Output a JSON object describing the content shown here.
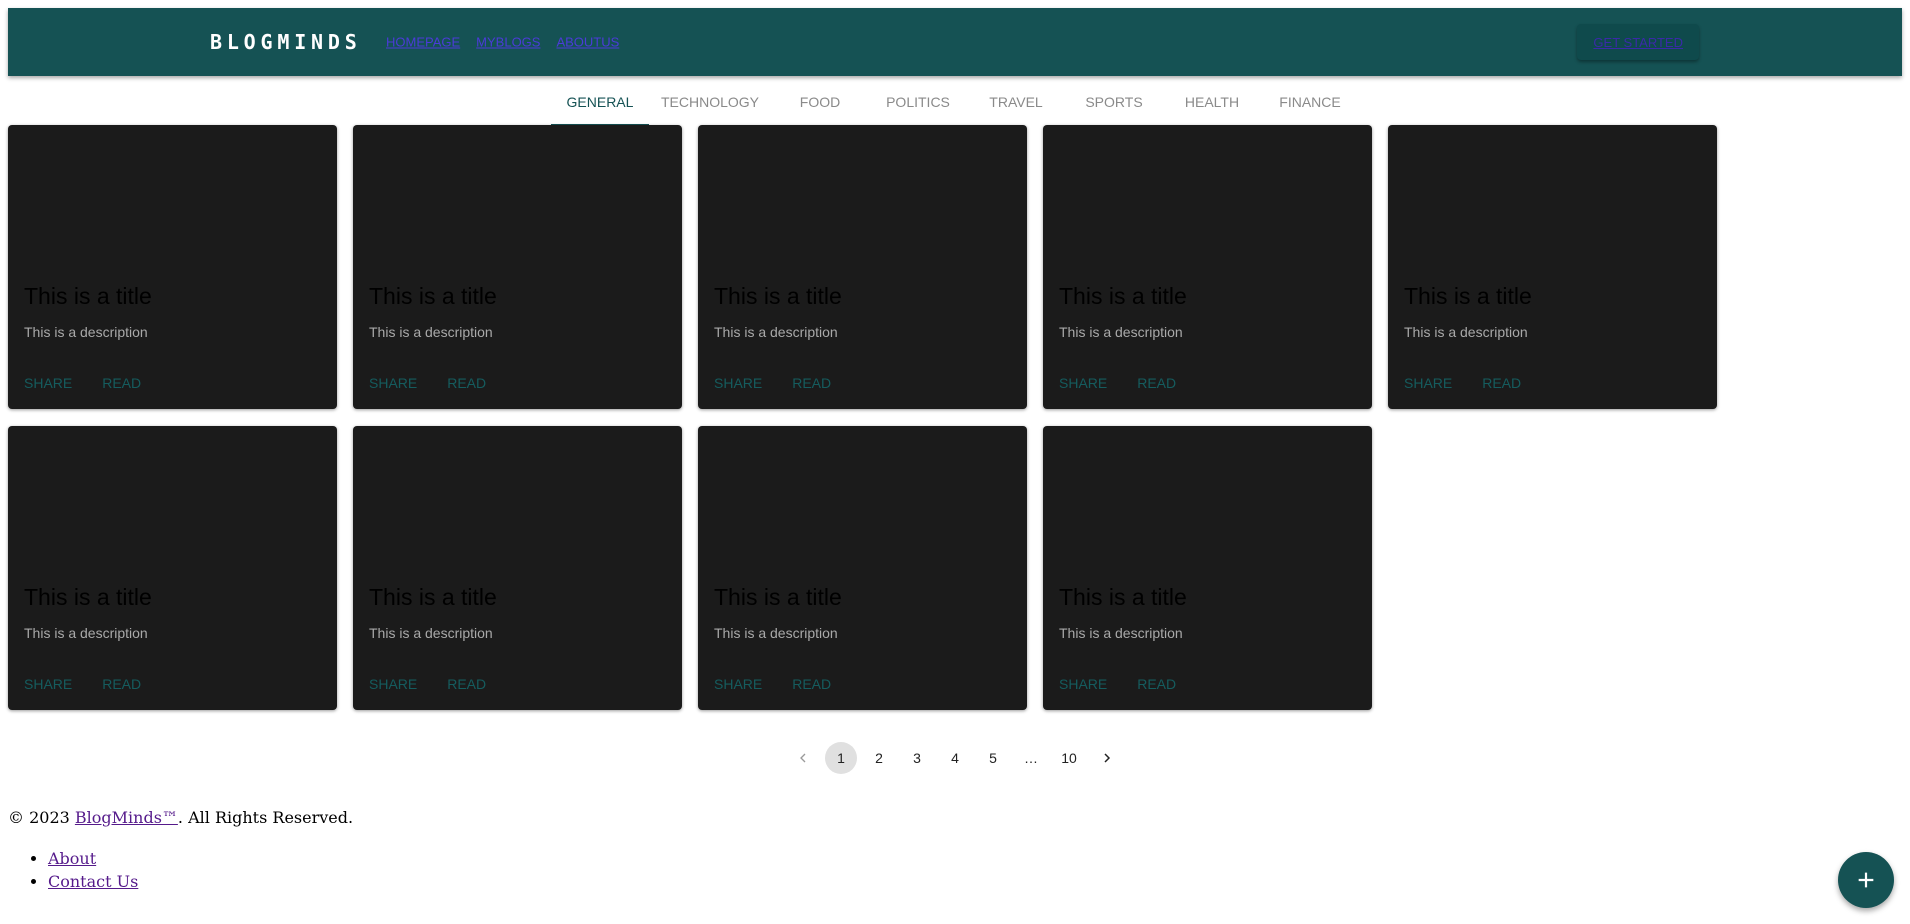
{
  "header": {
    "brand": "BLOGMINDS",
    "nav": [
      "HOMEPAGE",
      "MYBLOGS",
      "ABOUTUS"
    ],
    "cta_label": "GET STARTED"
  },
  "tabs": [
    "GENERAL",
    "TECHNOLOGY",
    "FOOD",
    "POLITICS",
    "TRAVEL",
    "SPORTS",
    "HEALTH",
    "FINANCE"
  ],
  "active_tab": "GENERAL",
  "cards": [
    {
      "title": "This is a title",
      "description": "This is a description",
      "share_label": "SHARE",
      "read_label": "READ"
    },
    {
      "title": "This is a title",
      "description": "This is a description",
      "share_label": "SHARE",
      "read_label": "READ"
    },
    {
      "title": "This is a title",
      "description": "This is a description",
      "share_label": "SHARE",
      "read_label": "READ"
    },
    {
      "title": "This is a title",
      "description": "This is a description",
      "share_label": "SHARE",
      "read_label": "READ"
    },
    {
      "title": "This is a title",
      "description": "This is a description",
      "share_label": "SHARE",
      "read_label": "READ"
    },
    {
      "title": "This is a title",
      "description": "This is a description",
      "share_label": "SHARE",
      "read_label": "READ"
    },
    {
      "title": "This is a title",
      "description": "This is a description",
      "share_label": "SHARE",
      "read_label": "READ"
    },
    {
      "title": "This is a title",
      "description": "This is a description",
      "share_label": "SHARE",
      "read_label": "READ"
    },
    {
      "title": "This is a title",
      "description": "This is a description",
      "share_label": "SHARE",
      "read_label": "READ"
    }
  ],
  "pagination": {
    "prev_icon": "chevron-left-icon",
    "pages": [
      "1",
      "2",
      "3",
      "4",
      "5",
      "…",
      "10"
    ],
    "current": "1",
    "next_icon": "chevron-right-icon"
  },
  "footer": {
    "copyright_prefix": "© 2023 ",
    "brand_link": "BlogMinds™",
    "copyright_suffix": ". All Rights Reserved.",
    "links": [
      "About",
      "Contact Us"
    ]
  },
  "fab": {
    "icon": "plus-icon"
  },
  "colors": {
    "primary": "#155254",
    "card_bg": "#1b1b1b",
    "action_text": "#155c5e",
    "link": "#551a8b"
  }
}
